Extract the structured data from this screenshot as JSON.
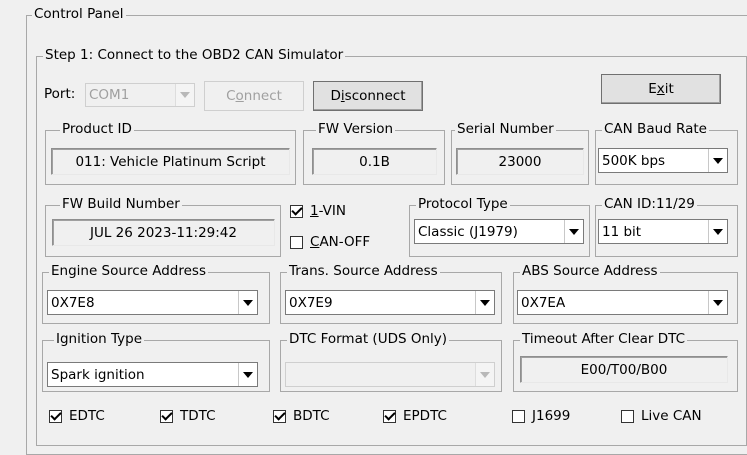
{
  "control_panel": {
    "title": "Control Panel"
  },
  "step1": {
    "title": "Step 1: Connect to the OBD2 CAN Simulator",
    "port_label": "Port:",
    "port_value": "COM1",
    "connect_pre": "C",
    "connect_ul": "o",
    "connect_post": "nnect",
    "disconnect_pre": "D",
    "disconnect_ul": "i",
    "disconnect_post": "sconnect",
    "exit_pre": "E",
    "exit_ul": "x",
    "exit_post": "it"
  },
  "product_id": {
    "label": "Product ID",
    "value": "011: Vehicle Platinum Script"
  },
  "fw_version": {
    "label": "FW Version",
    "value": "0.1B"
  },
  "serial_number": {
    "label": "Serial Number",
    "value": "23000"
  },
  "can_baud_rate": {
    "label": "CAN Baud Rate",
    "value": "500K bps"
  },
  "fw_build": {
    "label": "FW Build Number",
    "value": "JUL 26 2023-11:29:42"
  },
  "vin": {
    "ul": "1",
    "post": "-VIN",
    "checked": true
  },
  "can_off": {
    "ul": "C",
    "post": "AN-OFF",
    "checked": false
  },
  "protocol_type": {
    "label": "Protocol Type",
    "value": "Classic (J1979)"
  },
  "can_id": {
    "label": "CAN ID:11/29",
    "value": "11 bit"
  },
  "engine_source": {
    "label": "Engine Source Address",
    "value": "0X7E8"
  },
  "trans_source": {
    "label": "Trans. Source Address",
    "value": "0X7E9"
  },
  "abs_source": {
    "label": "ABS Source Address",
    "value": "0X7EA"
  },
  "ignition_type": {
    "label": "Ignition Type",
    "value": "Spark ignition"
  },
  "dtc_format": {
    "label": "DTC Format (UDS Only)",
    "value": ""
  },
  "timeout_clear_dtc": {
    "label": "Timeout After Clear DTC",
    "value": "E00/T00/B00"
  },
  "dtc_checks": [
    {
      "label": "EDTC",
      "checked": true
    },
    {
      "label": "TDTC",
      "checked": true
    },
    {
      "label": "BDTC",
      "checked": true
    },
    {
      "label": "EPDTC",
      "checked": true
    },
    {
      "label": "J1699",
      "checked": false
    },
    {
      "label": "Live CAN",
      "checked": false
    }
  ]
}
